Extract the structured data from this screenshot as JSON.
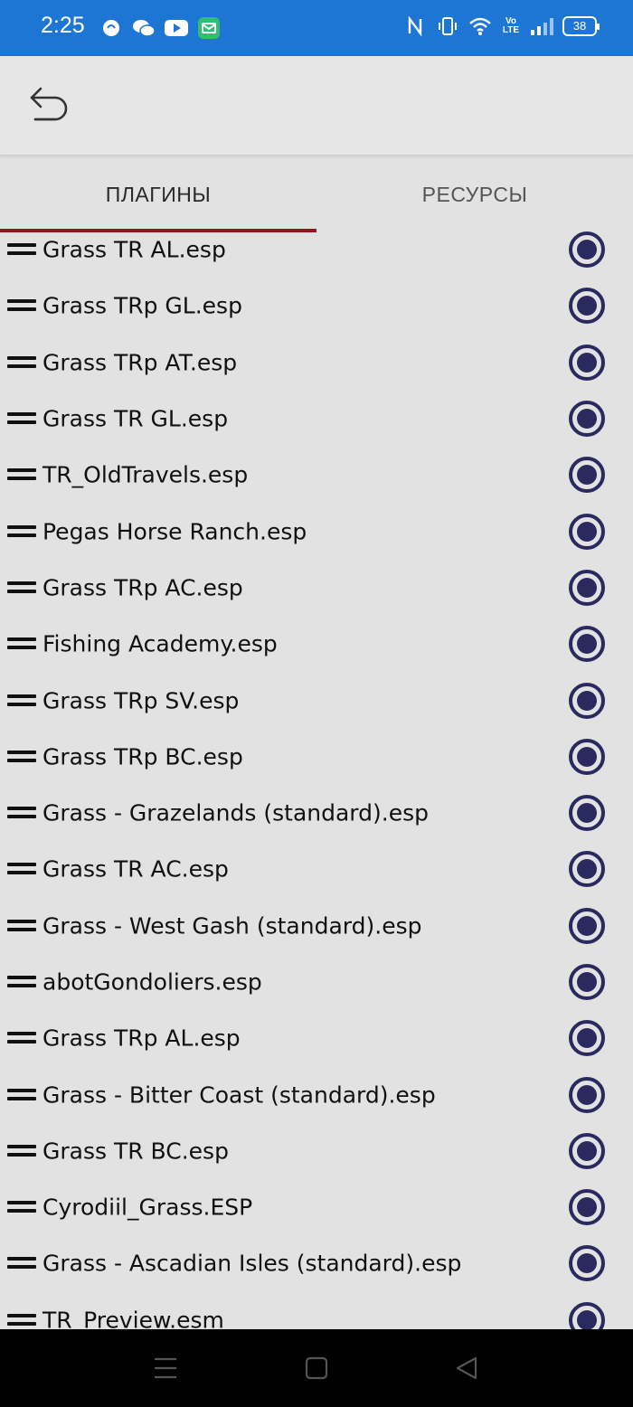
{
  "status_bar": {
    "time": "2:25",
    "left_icons": [
      "qq-icon",
      "wechat-icon",
      "youtube-icon",
      "mail-icon"
    ],
    "right_icons": [
      "nfc-icon",
      "vibrate-icon",
      "wifi-icon",
      "volte-icon",
      "signal-icon"
    ],
    "battery": "38",
    "volte_label": "Vo LTE",
    "color": "#1d76d4"
  },
  "toolbar": {
    "back_icon": "back-arrow-icon"
  },
  "tabs": [
    {
      "label": "ПЛАГИНЫ",
      "active": true
    },
    {
      "label": "РЕСУРСЫ",
      "active": false
    }
  ],
  "accent_color": "#8c1a1a",
  "radio_color": "#2a2a5e",
  "plugins": [
    {
      "name": "Grass TR AL.esp",
      "selected": true
    },
    {
      "name": "Grass TRp GL.esp",
      "selected": true
    },
    {
      "name": "Grass TRp AT.esp",
      "selected": true
    },
    {
      "name": "Grass TR GL.esp",
      "selected": true
    },
    {
      "name": "TR_OldTravels.esp",
      "selected": true
    },
    {
      "name": "Pegas Horse Ranch.esp",
      "selected": true
    },
    {
      "name": "Grass TRp AC.esp",
      "selected": true
    },
    {
      "name": "Fishing Academy.esp",
      "selected": true
    },
    {
      "name": "Grass TRp SV.esp",
      "selected": true
    },
    {
      "name": "Grass TRp BC.esp",
      "selected": true
    },
    {
      "name": "Grass - Grazelands (standard).esp",
      "selected": true
    },
    {
      "name": "Grass TR AC.esp",
      "selected": true
    },
    {
      "name": "Grass - West Gash (standard).esp",
      "selected": true
    },
    {
      "name": "abotGondoliers.esp",
      "selected": true
    },
    {
      "name": "Grass TRp AL.esp",
      "selected": true
    },
    {
      "name": "Grass - Bitter Coast (standard).esp",
      "selected": true
    },
    {
      "name": "Grass TR BC.esp",
      "selected": true
    },
    {
      "name": "Cyrodiil_Grass.ESP",
      "selected": true
    },
    {
      "name": "Grass - Ascadian Isles (standard).esp",
      "selected": true
    },
    {
      "name": "TR_Preview.esm",
      "selected": true
    }
  ],
  "nav_bar": {
    "buttons": [
      "menu-icon",
      "home-icon",
      "back-icon"
    ]
  }
}
